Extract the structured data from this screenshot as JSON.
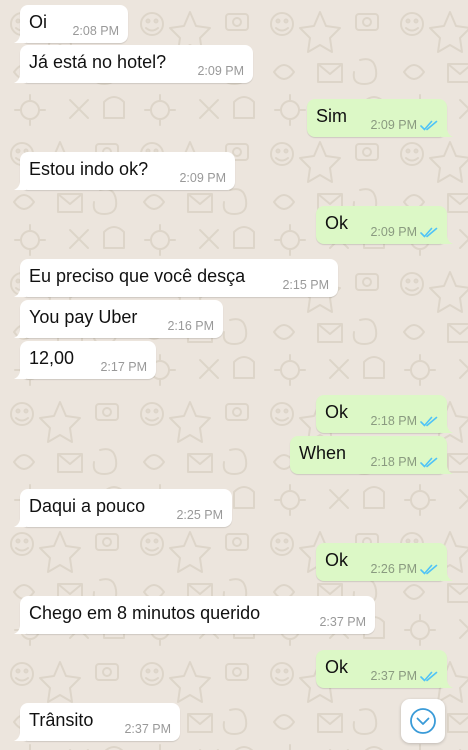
{
  "colors": {
    "incoming_bubble": "#ffffff",
    "outgoing_bubble": "#dcf8c6",
    "read_ticks": "#4fc3f7",
    "wallpaper": "#ece5dd"
  },
  "messages": [
    {
      "text": "Oi",
      "time": "2:08 PM",
      "direction": "in"
    },
    {
      "text": "Já está no hotel?",
      "time": "2:09 PM",
      "direction": "in"
    },
    {
      "text": "Sim",
      "time": "2:09 PM",
      "direction": "out",
      "status": "read"
    },
    {
      "text": "Estou indo ok?",
      "time": "2:09 PM",
      "direction": "in"
    },
    {
      "text": "Ok",
      "time": "2:09 PM",
      "direction": "out",
      "status": "read"
    },
    {
      "text": "Eu preciso que você desça",
      "time": "2:15 PM",
      "direction": "in"
    },
    {
      "text": "You pay Uber",
      "time": "2:16 PM",
      "direction": "in"
    },
    {
      "text": "12,00",
      "time": "2:17 PM",
      "direction": "in"
    },
    {
      "text": "Ok",
      "time": "2:18 PM",
      "direction": "out",
      "status": "read"
    },
    {
      "text": "When",
      "time": "2:18 PM",
      "direction": "out",
      "status": "read"
    },
    {
      "text": "Daqui a pouco",
      "time": "2:25 PM",
      "direction": "in"
    },
    {
      "text": "Ok",
      "time": "2:26 PM",
      "direction": "out",
      "status": "read"
    },
    {
      "text": "Chego em 8 minutos querido",
      "time": "2:37 PM",
      "direction": "in"
    },
    {
      "text": "Ok",
      "time": "2:37 PM",
      "direction": "out",
      "status": "read"
    },
    {
      "text": "Trânsito",
      "time": "2:37 PM",
      "direction": "in"
    }
  ],
  "scroll_button": {
    "icon": "chevron-down-icon"
  }
}
